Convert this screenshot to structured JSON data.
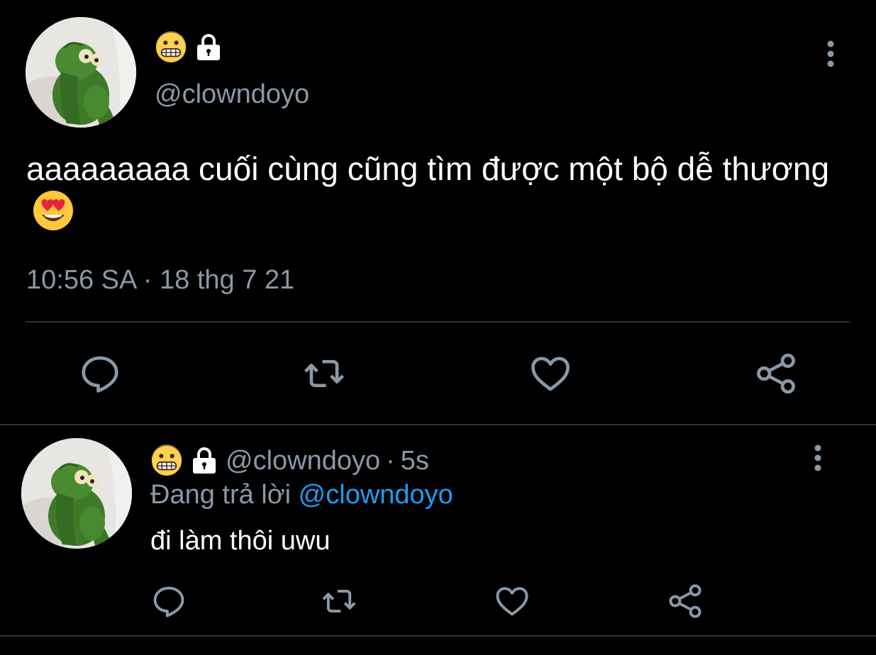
{
  "main_tweet": {
    "display_name_emoji": "grimacing-face",
    "protected": true,
    "handle": "@clowndoyo",
    "text": "aaaaaaaaa cuối cùng cũng tìm được một bộ dễ thương",
    "text_emoji": "smiling-face-with-heart-eyes",
    "timestamp": "10:56 SA · 18 thg 7 21",
    "actions": [
      "reply-icon",
      "retweet-icon",
      "like-icon",
      "share-icon"
    ]
  },
  "reply_tweet": {
    "display_name_emoji": "grimacing-face",
    "protected": true,
    "handle": "@clowndoyo",
    "separator": "·",
    "age": "5s",
    "replying_prefix": "Đang trả lời",
    "replying_to": "@clowndoyo",
    "text": "đi làm thôi uwu",
    "actions": [
      "reply-icon",
      "retweet-icon",
      "like-icon",
      "share-icon"
    ]
  },
  "colors": {
    "background": "#000000",
    "text": "#ffffff",
    "secondary": "#8b98a5",
    "link": "#1d9bf0",
    "divider": "#2f3336"
  }
}
